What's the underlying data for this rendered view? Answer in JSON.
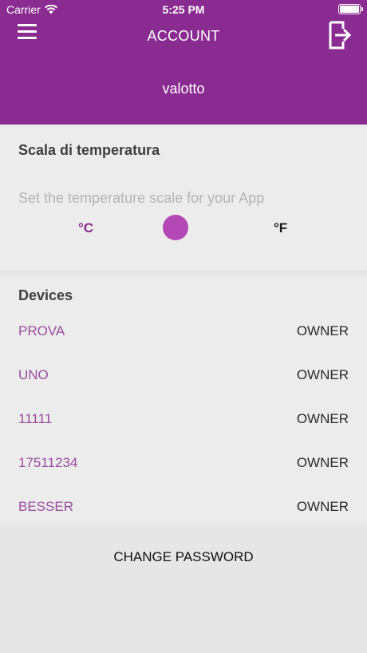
{
  "status_bar": {
    "carrier": "Carrier",
    "time": "5:25 PM"
  },
  "header": {
    "title": "ACCOUNT",
    "username": "valotto"
  },
  "temperature": {
    "title": "Scala di temperatura",
    "description": "Set the temperature scale for your App",
    "celsius_label": "°C",
    "fahrenheit_label": "°F",
    "selected": "°C"
  },
  "devices": {
    "title": "Devices",
    "items": [
      {
        "name": "PROVA",
        "role": "OWNER"
      },
      {
        "name": "UNO",
        "role": "OWNER"
      },
      {
        "name": "11111",
        "role": "OWNER"
      },
      {
        "name": "17511234",
        "role": "OWNER"
      },
      {
        "name": "BESSER",
        "role": "OWNER"
      }
    ]
  },
  "actions": {
    "change_password": "CHANGE PASSWORD"
  },
  "colors": {
    "accent": "#8a2b91",
    "toggle": "#b347b5",
    "background": "#e6e6e6",
    "card": "#ececec"
  }
}
